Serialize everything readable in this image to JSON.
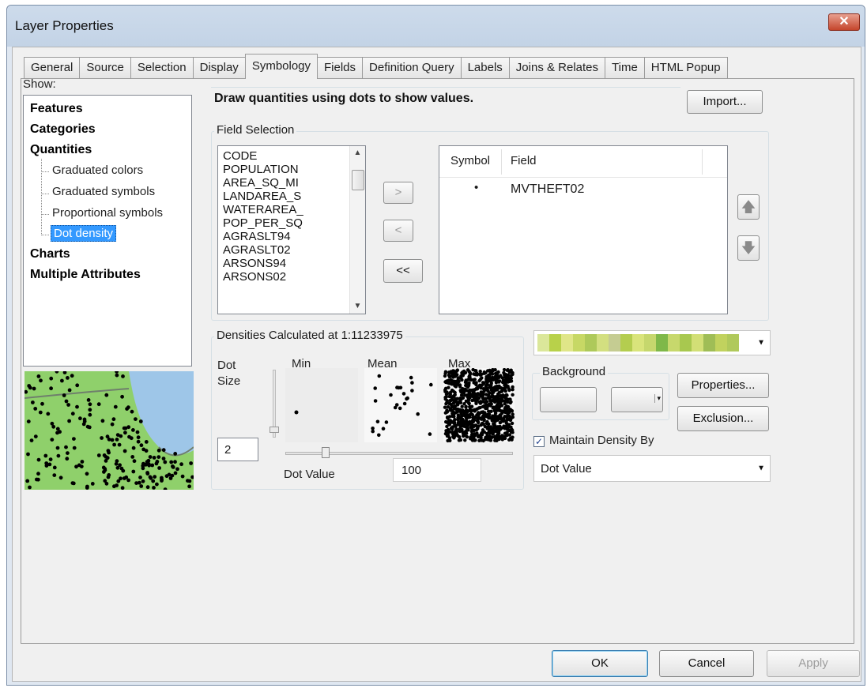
{
  "window": {
    "title": "Layer Properties",
    "close_glyph": "✕"
  },
  "tabs": [
    "General",
    "Source",
    "Selection",
    "Display",
    "Symbology",
    "Fields",
    "Definition Query",
    "Labels",
    "Joins & Relates",
    "Time",
    "HTML Popup"
  ],
  "active_tab": "Symbology",
  "show_panel": {
    "label": "Show:",
    "items": [
      "Features",
      "Categories",
      "Quantities"
    ],
    "sub_items": [
      "Graduated colors",
      "Graduated symbols",
      "Proportional symbols",
      "Dot density"
    ],
    "selected_sub_item": "Dot density",
    "bottom_items": [
      "Charts",
      "Multiple Attributes"
    ]
  },
  "description": "Draw quantities using dots to show values.",
  "import_button": "Import...",
  "field_selection": {
    "label": "Field Selection",
    "fields": [
      "CODE",
      "POPULATION",
      "AREA_SQ_MI",
      "LANDAREA_S",
      "WATERAREA_",
      "POP_PER_SQ",
      "AGRASLT94",
      "AGRASLT02",
      "ARSONS94",
      "ARSONS02"
    ],
    "move_right": ">",
    "move_left": "<",
    "move_all_left": "<<",
    "symbol_header": "Symbol",
    "field_header": "Field",
    "selected_fields": [
      {
        "symbol": "•",
        "field": "MVTHEFT02"
      }
    ],
    "up_glyph": "🡅",
    "down_glyph": "🡇"
  },
  "densities": {
    "label": "Densities Calculated at 1:11233975",
    "dot_size_label_1": "Dot",
    "dot_size_label_2": "Size",
    "dot_size_value": "2",
    "min_label": "Min",
    "mean_label": "Mean",
    "max_label": "Max",
    "dot_value_label": "Dot Value",
    "dot_value": "100"
  },
  "color_ramp": {
    "colors": [
      "#dbe79a",
      "#b8d14a",
      "#e0e688",
      "#c7d865",
      "#aec95a",
      "#d3df80",
      "#c5cc92",
      "#b4cd4f",
      "#d9e47b",
      "#c6d76d",
      "#7fb849",
      "#c7d86c",
      "#a8c84f",
      "#d2df76",
      "#9fbd56",
      "#c1d25e",
      "#b0c95b"
    ]
  },
  "background": {
    "label": "Background"
  },
  "properties_button": "Properties...",
  "exclusion_button": "Exclusion...",
  "maintain_density": {
    "label": "Maintain Density By",
    "checked": true,
    "check_glyph": "✓"
  },
  "maintain_density_value": "Dot Value",
  "footer": {
    "ok": "OK",
    "cancel": "Cancel",
    "apply": "Apply"
  },
  "colors": {
    "selected_bg": "#3399ff",
    "map_green": "#8fd06b",
    "map_water": "#9ec6e8"
  }
}
